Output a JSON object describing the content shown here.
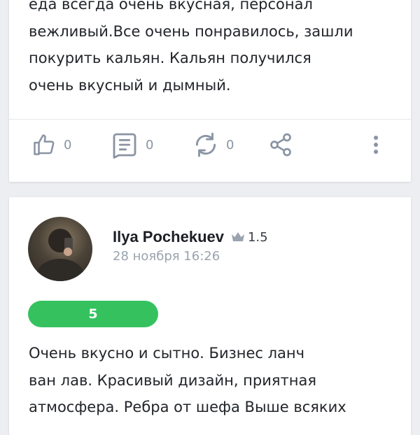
{
  "review1": {
    "text": "еда всегда очень вкусная, персонал\nвежливый.Все очень понравилось, зашли\nпокурить кальян. Кальян получился\nочень вкусный и дымный.",
    "actions": {
      "likes": "0",
      "comments": "0",
      "reposts": "0"
    }
  },
  "review2": {
    "author": "Ilya Pochekuev",
    "level": "1.5",
    "date": "28 ноября 16:26",
    "score": "5",
    "text": "Очень вкусно и сытно. Бизнес ланч\nван лав. Красивый дизайн, приятная\nатмосфера. Ребра от шефа Выше всяких"
  },
  "icons": [
    "like-icon",
    "comment-icon",
    "repost-icon",
    "share-icon",
    "more-icon",
    "crown-icon"
  ],
  "colors": {
    "score_green": "#35c25e",
    "icon_gray": "#8a94a3",
    "background": "#eceef1"
  }
}
